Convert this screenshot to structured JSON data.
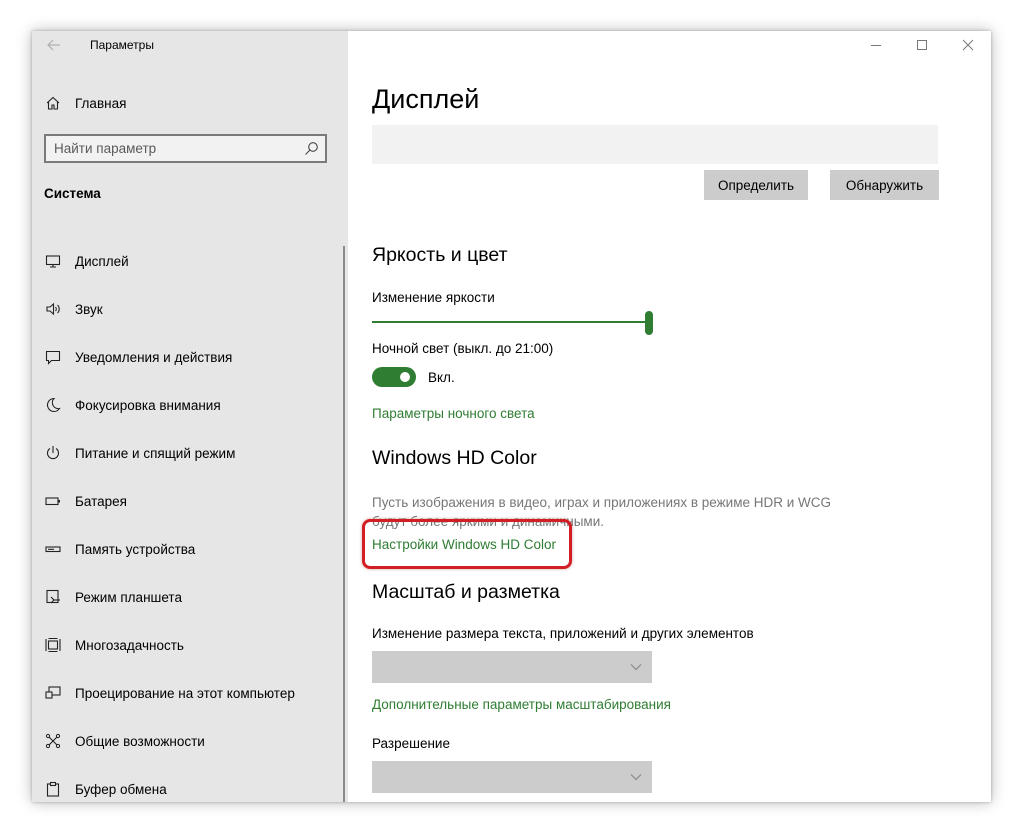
{
  "window": {
    "app_title": "Параметры"
  },
  "sidebar": {
    "home_label": "Главная",
    "search_placeholder": "Найти параметр",
    "section_title": "Система",
    "items": [
      {
        "label": "Дисплей",
        "icon": "monitor-icon"
      },
      {
        "label": "Звук",
        "icon": "speaker-icon"
      },
      {
        "label": "Уведомления и действия",
        "icon": "notification-icon"
      },
      {
        "label": "Фокусировка внимания",
        "icon": "moon-icon"
      },
      {
        "label": "Питание и спящий режим",
        "icon": "power-icon"
      },
      {
        "label": "Батарея",
        "icon": "battery-icon"
      },
      {
        "label": "Память устройства",
        "icon": "storage-icon"
      },
      {
        "label": "Режим планшета",
        "icon": "tablet-mode-icon"
      },
      {
        "label": "Многозадачность",
        "icon": "multitasking-icon"
      },
      {
        "label": "Проецирование на этот компьютер",
        "icon": "projecting-icon"
      },
      {
        "label": "Общие возможности",
        "icon": "shared-experiences-icon"
      },
      {
        "label": "Буфер обмена",
        "icon": "clipboard-icon"
      }
    ]
  },
  "main": {
    "title": "Дисплей",
    "identify_button": "Определить",
    "detect_button": "Обнаружить",
    "brightness_section": {
      "heading": "Яркость и цвет",
      "brightness_label": "Изменение яркости",
      "brightness_value_pct": 100,
      "night_light_label": "Ночной свет (выкл. до 21:00)",
      "night_light_state": "Вкл.",
      "night_light_settings_link": "Параметры ночного света"
    },
    "hd_color_section": {
      "heading": "Windows HD Color",
      "description": "Пусть изображения в видео, играх и приложениях в режиме HDR и WCG будут более яркими и динамичными.",
      "settings_link": "Настройки Windows HD Color"
    },
    "scale_section": {
      "heading": "Масштаб и разметка",
      "scale_label": "Изменение размера текста, приложений и других элементов",
      "scale_value": "",
      "advanced_scaling_link": "Дополнительные параметры масштабирования",
      "resolution_label": "Разрешение",
      "resolution_value": ""
    }
  },
  "colors": {
    "accent": "#2e7d32",
    "highlight_border": "#d21f25",
    "sidebar_bg": "#e6e6e6"
  }
}
